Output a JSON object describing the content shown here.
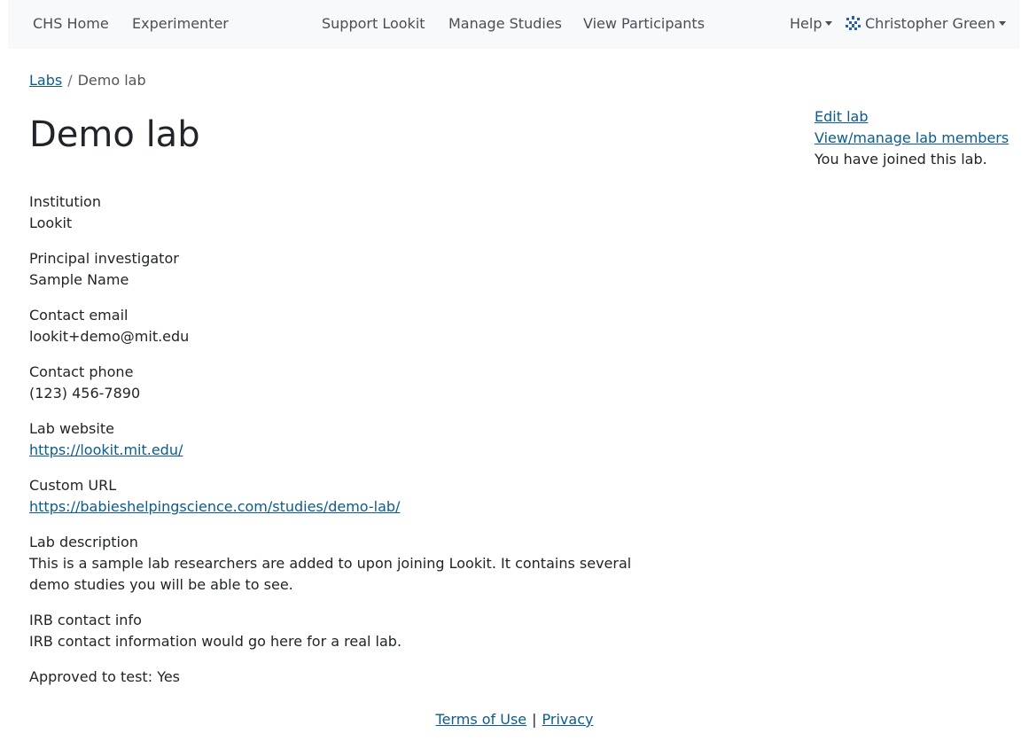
{
  "nav": {
    "home": "CHS Home",
    "experimenter": "Experimenter",
    "support": "Support Lookit",
    "manage_studies": "Manage Studies",
    "view_participants": "View Participants",
    "help": "Help",
    "user": "Christopher Green",
    "user_icon": "user-avatar-icon"
  },
  "breadcrumb": {
    "labs": "Labs",
    "separator": "/",
    "current": "Demo lab"
  },
  "page": {
    "title": "Demo lab"
  },
  "actions": {
    "edit": "Edit lab",
    "members": "View/manage lab members",
    "joined_note": "You have joined this lab."
  },
  "fields": {
    "institution": {
      "label": "Institution",
      "value": "Lookit"
    },
    "pi": {
      "label": "Principal investigator",
      "value": "Sample Name"
    },
    "email": {
      "label": "Contact email",
      "value": "lookit+demo@mit.edu"
    },
    "phone": {
      "label": "Contact phone",
      "value": "(123) 456-7890"
    },
    "website": {
      "label": "Lab website",
      "value": "https://lookit.mit.edu/"
    },
    "custom_url": {
      "label": "Custom URL",
      "value": "https://babieshelpingscience.com/studies/demo-lab/"
    },
    "description": {
      "label": "Lab description",
      "value": "This is a sample lab researchers are added to upon joining Lookit. It contains several demo studies you will be able to see."
    },
    "irb": {
      "label": "IRB contact info",
      "value": "IRB contact information would go here for a real lab."
    },
    "approved": {
      "label": "Approved to test:",
      "value": "Yes"
    }
  },
  "footer": {
    "terms": "Terms of Use",
    "separator": "|",
    "privacy": "Privacy"
  },
  "colors": {
    "link": "#0b5b8e",
    "navbar_bg": "#f8f9fa",
    "text": "#212529"
  }
}
